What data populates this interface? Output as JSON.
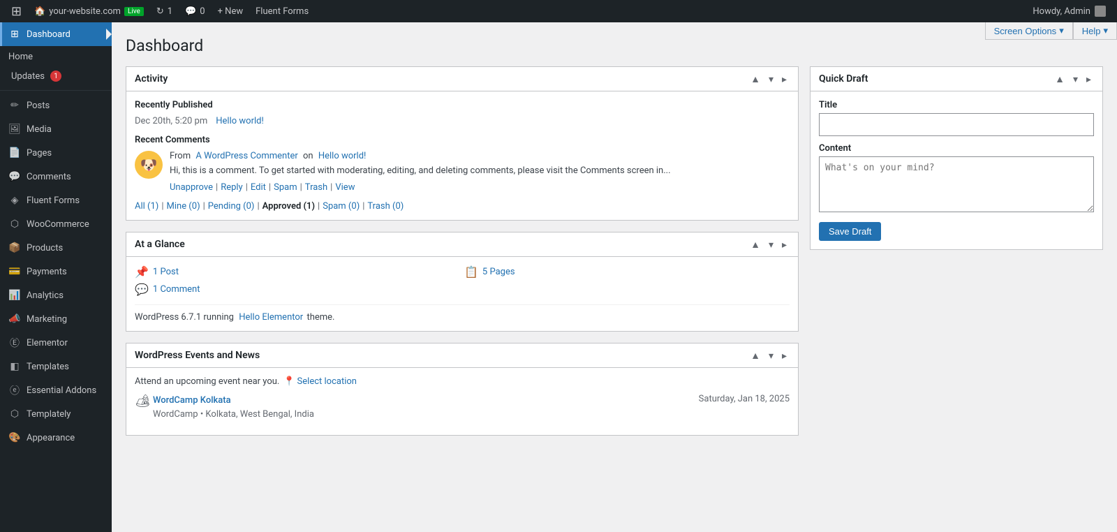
{
  "adminbar": {
    "logo_label": "WordPress",
    "site_name": "your-website.com",
    "live_badge": "Live",
    "revisions_count": "1",
    "comments_count": "0",
    "new_label": "+ New",
    "fluent_forms_label": "Fluent Forms",
    "howdy_text": "Howdy, Admin"
  },
  "screen_options": {
    "label": "Screen Options",
    "help_label": "Help"
  },
  "sidebar": {
    "dashboard_label": "Dashboard",
    "home_label": "Home",
    "updates_label": "Updates",
    "updates_badge": "1",
    "items": [
      {
        "id": "posts",
        "label": "Posts",
        "icon": "✏"
      },
      {
        "id": "media",
        "label": "Media",
        "icon": "🖼"
      },
      {
        "id": "pages",
        "label": "Pages",
        "icon": "📄"
      },
      {
        "id": "comments",
        "label": "Comments",
        "icon": "💬"
      },
      {
        "id": "fluent-forms",
        "label": "Fluent Forms",
        "icon": "⬡"
      },
      {
        "id": "woocommerce",
        "label": "WooCommerce",
        "icon": "⬡"
      },
      {
        "id": "products",
        "label": "Products",
        "icon": "📦"
      },
      {
        "id": "payments",
        "label": "Payments",
        "icon": "💳"
      },
      {
        "id": "analytics",
        "label": "Analytics",
        "icon": "📊"
      },
      {
        "id": "marketing",
        "label": "Marketing",
        "icon": "📣"
      },
      {
        "id": "elementor",
        "label": "Elementor",
        "icon": "Ⓔ"
      },
      {
        "id": "templates",
        "label": "Templates",
        "icon": "◧"
      },
      {
        "id": "essential-addons",
        "label": "Essential Addons",
        "icon": "ⓔ"
      },
      {
        "id": "templately",
        "label": "Templately",
        "icon": "⬡"
      },
      {
        "id": "appearance",
        "label": "Appearance",
        "icon": "🎨"
      }
    ]
  },
  "page": {
    "title": "Dashboard"
  },
  "activity_widget": {
    "title": "Activity",
    "recently_published_label": "Recently Published",
    "post_date": "Dec 20th, 5:20 pm",
    "post_link": "Hello world!",
    "recent_comments_label": "Recent Comments",
    "comment": {
      "from_prefix": "From",
      "commenter_name": "A WordPress Commenter",
      "on_text": "on",
      "post_name": "Hello world!",
      "body": "Hi, this is a comment. To get started with moderating, editing, and deleting comments, please visit the Comments screen in...",
      "actions": [
        {
          "label": "Unapprove"
        },
        {
          "label": "Reply"
        },
        {
          "label": "Edit"
        },
        {
          "label": "Spam"
        },
        {
          "label": "Trash"
        },
        {
          "label": "View"
        }
      ]
    },
    "filters": [
      {
        "label": "All (1)",
        "active": false
      },
      {
        "label": "Mine (0)",
        "active": false
      },
      {
        "label": "Pending (0)",
        "active": false
      },
      {
        "label": "Approved (1)",
        "active": true
      },
      {
        "label": "Spam (0)",
        "active": false
      },
      {
        "label": "Trash (0)",
        "active": false
      }
    ]
  },
  "glance_widget": {
    "title": "At a Glance",
    "items": [
      {
        "icon": "📌",
        "text": "1 Post"
      },
      {
        "icon": "📋",
        "text": "5 Pages"
      },
      {
        "icon": "💬",
        "text": "1 Comment"
      }
    ],
    "wp_version": "WordPress 6.7.1 running",
    "theme_link": "Hello Elementor",
    "theme_suffix": "theme."
  },
  "quick_draft_widget": {
    "title": "Quick Draft",
    "title_label": "Title",
    "title_placeholder": "",
    "content_label": "Content",
    "content_placeholder": "What's on your mind?",
    "save_btn": "Save Draft"
  },
  "wp_events_widget": {
    "title": "WordPress Events and News",
    "description": "Attend an upcoming event near you.",
    "select_location": "Select location",
    "event": {
      "name": "WordCamp Kolkata",
      "date": "Saturday, Jan 18, 2025",
      "location": "WordCamp • Kolkata, West Bengal, India"
    }
  }
}
